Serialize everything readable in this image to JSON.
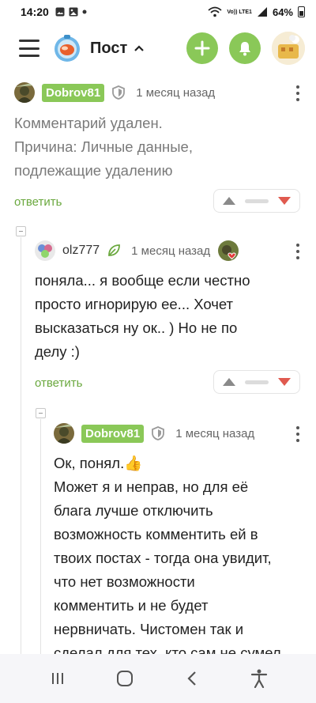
{
  "status_bar": {
    "time": "14:20",
    "battery": "64%",
    "network_label": "Vo)) LTE1",
    "icons": [
      "picture-icon",
      "image-icon",
      "dot-icon",
      "wifi-icon",
      "signal-icon",
      "battery-icon"
    ]
  },
  "header": {
    "title": "Пост",
    "icons": [
      "hamburger-menu-icon",
      "logo",
      "chevron-up-icon",
      "plus-icon",
      "bell-icon",
      "avatar"
    ],
    "accent": "#8ac858"
  },
  "comments": [
    {
      "author": "Dobrov81",
      "author_badge": true,
      "time": "1 месяц назад",
      "lines": [
        "Комментарий удален.",
        "Причина: Личные данные,",
        "подлежащие удалению"
      ],
      "reply_label": "ответить"
    },
    {
      "author": "olz777",
      "author_badge": false,
      "time": "1 месяц назад",
      "lines": [
        "поняла... я вообще если честно",
        "просто игнорирую ее... Хочет",
        "высказаться ну ок.. ) Но не по",
        "делу :)"
      ],
      "reply_label": "ответить"
    },
    {
      "author": "Dobrov81",
      "author_badge": true,
      "time": "1 месяц назад",
      "lines": [
        "Ок, понял.👍",
        "Может я и неправ, но для её",
        "блага лучше отключить",
        "возможность комментить ей в",
        "твоих постах - тогда она увидит,",
        "что нет возможности",
        "комментить и не будет",
        "нервничать. Чистомен так и",
        "сделал для тех, кто сам не сумел"
      ]
    }
  ],
  "vote_colors": {
    "up": "#8a8a8a",
    "down": "#e05a4f"
  },
  "nav": [
    "recent-apps-icon",
    "home-icon",
    "back-icon",
    "accessibility-icon"
  ]
}
